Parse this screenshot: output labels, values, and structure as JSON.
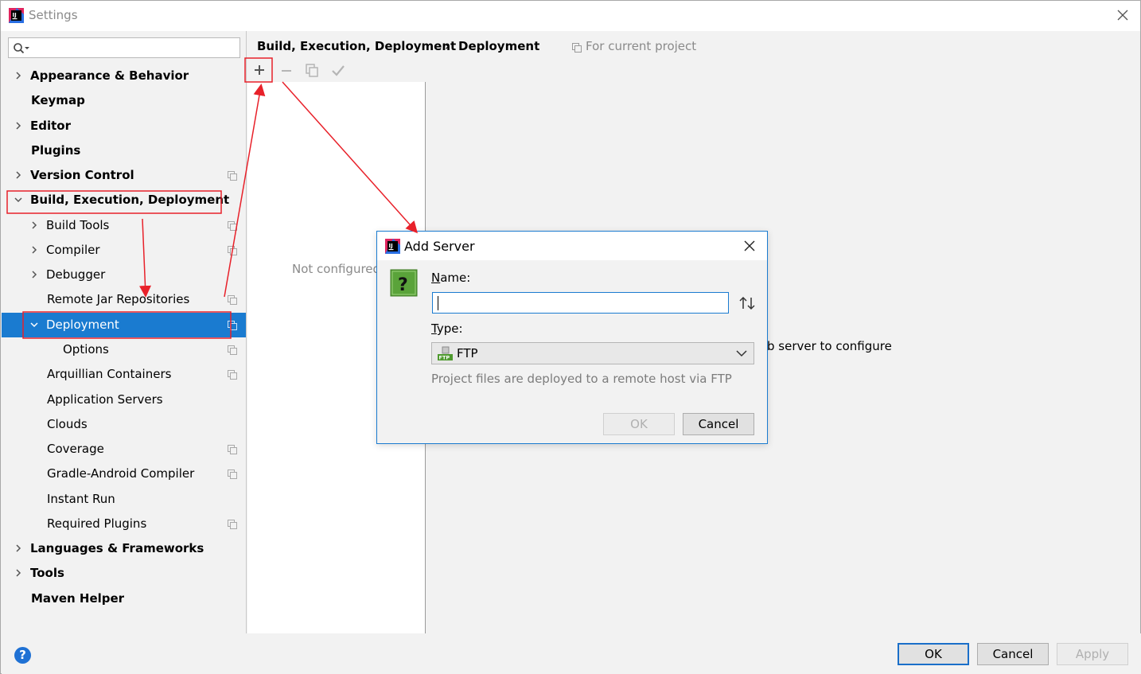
{
  "window": {
    "title": "Settings"
  },
  "sidebar": {
    "items": [
      {
        "label": "Appearance & Behavior",
        "bold": true,
        "expandable": true,
        "expanded": false,
        "level": 0,
        "project": false
      },
      {
        "label": "Keymap",
        "bold": true,
        "expandable": false,
        "level": 0,
        "project": false
      },
      {
        "label": "Editor",
        "bold": true,
        "expandable": true,
        "expanded": false,
        "level": 0,
        "project": false
      },
      {
        "label": "Plugins",
        "bold": true,
        "expandable": false,
        "level": 0,
        "project": false
      },
      {
        "label": "Version Control",
        "bold": true,
        "expandable": true,
        "expanded": false,
        "level": 0,
        "project": true
      },
      {
        "label": "Build, Execution, Deployment",
        "bold": true,
        "expandable": true,
        "expanded": true,
        "level": 0,
        "project": false
      },
      {
        "label": "Build Tools",
        "bold": false,
        "expandable": true,
        "expanded": false,
        "level": 1,
        "project": true
      },
      {
        "label": "Compiler",
        "bold": false,
        "expandable": true,
        "expanded": false,
        "level": 1,
        "project": true
      },
      {
        "label": "Debugger",
        "bold": false,
        "expandable": true,
        "expanded": false,
        "level": 1,
        "project": false
      },
      {
        "label": "Remote Jar Repositories",
        "bold": false,
        "expandable": false,
        "level": 1,
        "project": true
      },
      {
        "label": "Deployment",
        "bold": false,
        "expandable": true,
        "expanded": true,
        "level": 1,
        "project": true,
        "selected": true
      },
      {
        "label": "Options",
        "bold": false,
        "expandable": false,
        "level": 2,
        "project": true
      },
      {
        "label": "Arquillian Containers",
        "bold": false,
        "expandable": false,
        "level": 1,
        "project": true
      },
      {
        "label": "Application Servers",
        "bold": false,
        "expandable": false,
        "level": 1,
        "project": false
      },
      {
        "label": "Clouds",
        "bold": false,
        "expandable": false,
        "level": 1,
        "project": false
      },
      {
        "label": "Coverage",
        "bold": false,
        "expandable": false,
        "level": 1,
        "project": true
      },
      {
        "label": "Gradle-Android Compiler",
        "bold": false,
        "expandable": false,
        "level": 1,
        "project": true
      },
      {
        "label": "Instant Run",
        "bold": false,
        "expandable": false,
        "level": 1,
        "project": false
      },
      {
        "label": "Required Plugins",
        "bold": false,
        "expandable": false,
        "level": 1,
        "project": true
      },
      {
        "label": "Languages & Frameworks",
        "bold": true,
        "expandable": true,
        "expanded": false,
        "level": 0,
        "project": false
      },
      {
        "label": "Tools",
        "bold": true,
        "expandable": true,
        "expanded": false,
        "level": 0,
        "project": false
      },
      {
        "label": "Maven Helper",
        "bold": true,
        "expandable": false,
        "level": 0,
        "project": false
      }
    ]
  },
  "main": {
    "breadcrumb": {
      "parent": "Build, Execution, Deployment",
      "separator": "›",
      "current": "Deployment"
    },
    "scope_label": "For current project",
    "empty_list_text": "Not configured",
    "hint_text": "b server to configure"
  },
  "toolbar": {
    "add_icon": "plus-icon",
    "remove_icon": "minus-icon",
    "copy_icon": "copy-icon",
    "apply_icon": "check-icon"
  },
  "dialog": {
    "title": "Add Server",
    "name_label_mnemonic": "N",
    "name_label_rest": "ame:",
    "name_value": "",
    "type_label_mnemonic": "T",
    "type_label_rest": "ype:",
    "type_value": "FTP",
    "type_description": "Project files are deployed to a remote host via FTP",
    "ok_label": "OK",
    "cancel_label": "Cancel"
  },
  "footer": {
    "help_label": "?",
    "ok_label": "OK",
    "cancel_label": "Cancel",
    "apply_label": "Apply"
  },
  "colors": {
    "selection": "#1a7bd0",
    "annotation": "#e8212a",
    "help": "#1f71d4"
  }
}
